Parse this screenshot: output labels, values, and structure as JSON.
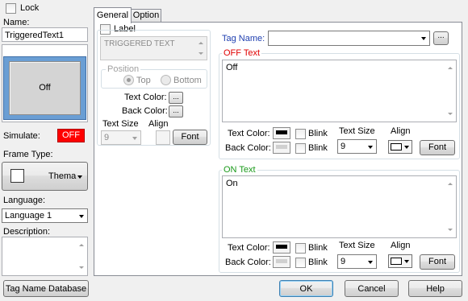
{
  "left": {
    "lock_label": "Lock",
    "name_label": "Name:",
    "name_value": "TriggeredText1",
    "preview_text": "Off",
    "simulate_label": "Simulate:",
    "simulate_value": "OFF",
    "frame_type_label": "Frame Type:",
    "frame_type_value": "Thema",
    "language_label": "Language:",
    "language_value": "Language 1",
    "description_label": "Description:",
    "tag_db_button": "Tag Name Database"
  },
  "tabs": [
    {
      "label": "General",
      "active": true
    },
    {
      "label": "Option",
      "active": false
    }
  ],
  "label_group": {
    "checkbox_label": "Label",
    "text": "TRIGGERED TEXT",
    "position_label": "Position",
    "top_label": "Top",
    "bottom_label": "Bottom",
    "text_color_label": "Text Color:",
    "back_color_label": "Back Color:",
    "ellipsis": "...",
    "text_size_label": "Text Size",
    "align_label": "Align",
    "text_size_value": "9",
    "font_button": "Font"
  },
  "tag": {
    "label": "Tag Name:",
    "value": "",
    "browse_button": "..."
  },
  "off_text": {
    "title": "OFF Text",
    "value": "Off",
    "text_color_label": "Text Color:",
    "back_color_label": "Back Color:",
    "blink_label": "Blink",
    "blink2_label": "Blink",
    "text_size_label": "Text Size",
    "align_label": "Align",
    "text_size_value": "9",
    "font_button": "Font"
  },
  "on_text": {
    "title": "ON Text",
    "value": "On",
    "text_color_label": "Text Color:",
    "back_color_label": "Back Color:",
    "blink_label": "Blink",
    "blink2_label": "Blink",
    "text_size_label": "Text Size",
    "align_label": "Align",
    "text_size_value": "9",
    "font_button": "Font"
  },
  "footer": {
    "ok": "OK",
    "cancel": "Cancel",
    "help": "Help"
  },
  "colors": {
    "off_title": "#e00000",
    "on_title": "#1a9a1a",
    "tag_label": "#1f3fb0",
    "simulate_bg": "#ff0000",
    "preview_frame": "#6a9ed4",
    "accent": "#3c7fb1"
  }
}
